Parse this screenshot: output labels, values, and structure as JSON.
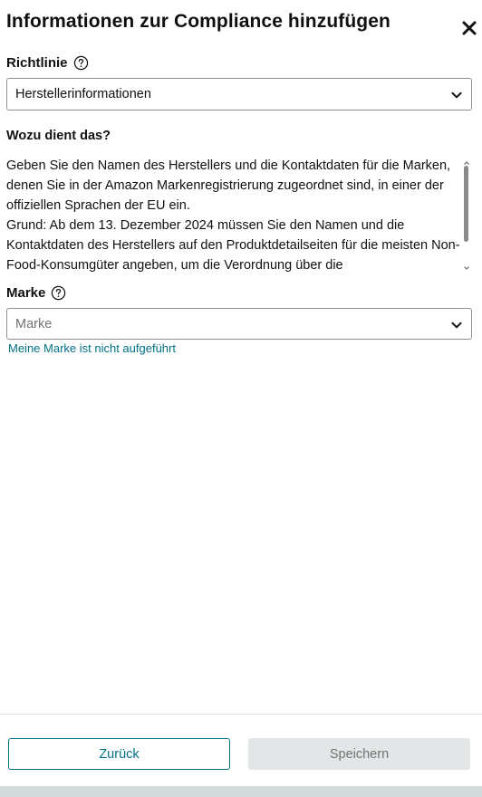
{
  "header": {
    "title": "Informationen zur Compliance hinzufügen"
  },
  "policy": {
    "label": "Richtlinie",
    "selected_value": "Herstellerinformationen"
  },
  "description": {
    "heading": "Wozu dient das?",
    "paragraph_1": "Geben Sie den Namen des Herstellers und die Kontaktdaten für die Marken, denen Sie in der Amazon Markenregistrierung zugeordnet sind, in einer der offiziellen Sprachen der EU ein.",
    "paragraph_2": "Grund: Ab dem 13. Dezember 2024 müssen Sie den Namen und die Kontaktdaten des Herstellers auf den Produktdetailseiten für die meisten Non-Food-Konsumgüter angeben, um die Verordnung über die"
  },
  "brand": {
    "label": "Marke",
    "placeholder": "Marke",
    "not_listed_link": "Meine Marke ist nicht aufgeführt"
  },
  "footer": {
    "back_label": "Zurück",
    "save_label": "Speichern"
  },
  "colors": {
    "link": "#007185",
    "disabled_button_bg": "#e3e6e6",
    "text": "#0f1111"
  }
}
